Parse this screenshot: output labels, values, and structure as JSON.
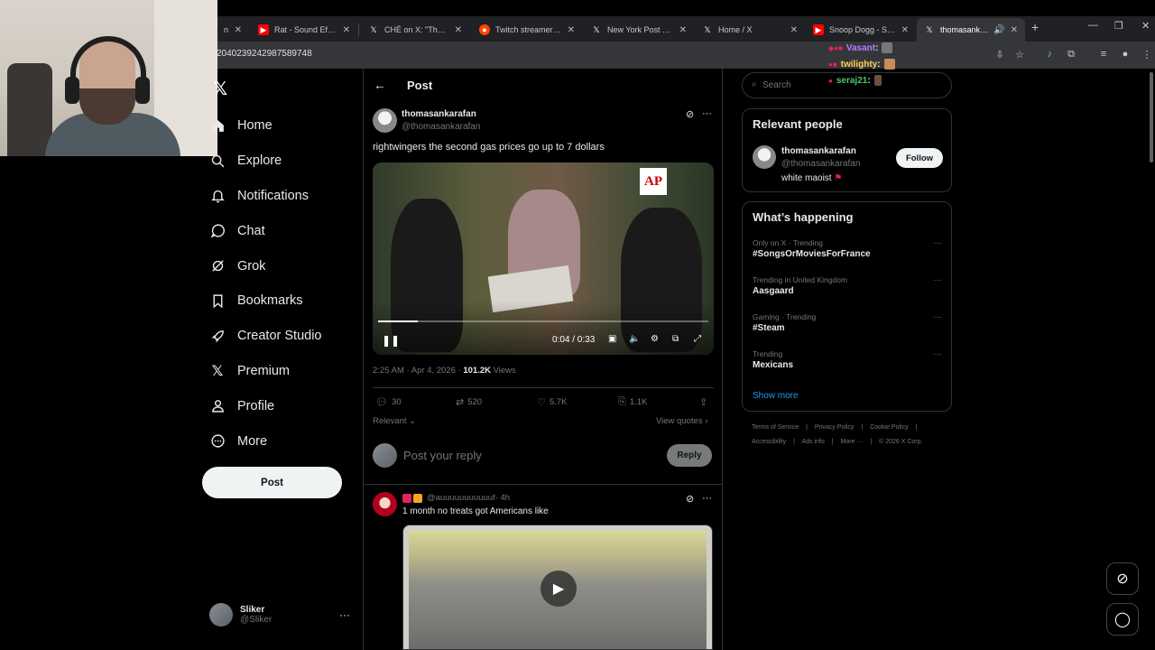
{
  "browser": {
    "tabs": [
      {
        "title": "n",
        "icon": "page-icon",
        "color": "#888888"
      },
      {
        "title": "Rat - Sound Effect | P",
        "icon": "youtube-icon",
        "color": "#ff0000"
      },
      {
        "title": "CHÉ on X: \"The tears",
        "icon": "x-icon",
        "color": "#ffffff"
      },
      {
        "title": "Twitch streamer Zoil",
        "icon": "reddit-icon",
        "color": "#ff4500"
      },
      {
        "title": "New York Post on X:",
        "icon": "x-icon",
        "color": "#ffffff"
      },
      {
        "title": "Home / X",
        "icon": "x-icon",
        "color": "#ffffff"
      },
      {
        "title": "Snoop Dogg - Stop C",
        "icon": "youtube-icon",
        "color": "#ff0000"
      },
      {
        "title": "thomasankarafan",
        "icon": "x-icon",
        "color": "#ffffff",
        "active": true
      }
    ],
    "url": "2040239242987589748"
  },
  "stream_chat": [
    {
      "user": "Vasant",
      "color": "#b57cff"
    },
    {
      "user": "twilighty",
      "color": "#ffd54a"
    },
    {
      "user": "seraj21",
      "color": "#46c96b"
    }
  ],
  "nav": {
    "items": [
      {
        "label": "Home",
        "icon": "home-icon"
      },
      {
        "label": "Explore",
        "icon": "search-icon"
      },
      {
        "label": "Notifications",
        "icon": "bell-icon"
      },
      {
        "label": "Chat",
        "icon": "chat-icon"
      },
      {
        "label": "Grok",
        "icon": "grok-icon"
      },
      {
        "label": "Bookmarks",
        "icon": "bookmark-icon"
      },
      {
        "label": "Creator Studio",
        "icon": "rocket-icon"
      },
      {
        "label": "Premium",
        "icon": "x-icon"
      },
      {
        "label": "Profile",
        "icon": "person-icon"
      },
      {
        "label": "More",
        "icon": "more-circle-icon"
      }
    ],
    "post_label": "Post"
  },
  "account": {
    "name": "Sliker",
    "handle": "@Sliker"
  },
  "header": {
    "title": "Post"
  },
  "post": {
    "author": "thomasankarafan",
    "handle": "@thomasankarafan",
    "text": "rightwingers the second gas prices go up to 7 dollars",
    "video": {
      "time": "0:04 / 0:33",
      "progress": 0.121,
      "logo": "AP"
    },
    "timestamp": "2:25 AM · Apr 4, 2026 · ",
    "views_count": "101.2K",
    "views_label": " Views",
    "replies": "30",
    "reposts": "520",
    "likes": "5.7K",
    "bookmarks": "1.1K",
    "sort_label": "Relevant",
    "view_quotes": "View quotes"
  },
  "reply_box": {
    "placeholder": "Post your reply",
    "button": "Reply"
  },
  "comment": {
    "handle": "@auuuuuuuuuuuf",
    "time": " · 4h",
    "text": "1 month no treats got Americans like"
  },
  "sidebar": {
    "search_placeholder": "Search",
    "relevant": {
      "title": "Relevant people",
      "name": "thomasankarafan",
      "handle": "@thomasankarafan",
      "bio": "white maoist",
      "follow": "Follow"
    },
    "happening": {
      "title": "What’s happening",
      "trends": [
        {
          "context": "Only on X · Trending",
          "topic": "#SongsOrMoviesForFrance"
        },
        {
          "context": "Trending in United Kingdom",
          "topic": "Aasgaard"
        },
        {
          "context": "Gaming · Trending",
          "topic": "#Steam"
        },
        {
          "context": "Trending",
          "topic": "Mexicans"
        }
      ],
      "show_more": "Show more"
    },
    "footer": {
      "row1": [
        "Terms of Service",
        "|",
        "Privacy Policy",
        "|",
        "Cookie Policy",
        "|"
      ],
      "row2": [
        "Accessibility",
        "|",
        "Ads info",
        "|",
        "More ···",
        "|",
        "© 2026 X Corp."
      ]
    }
  }
}
